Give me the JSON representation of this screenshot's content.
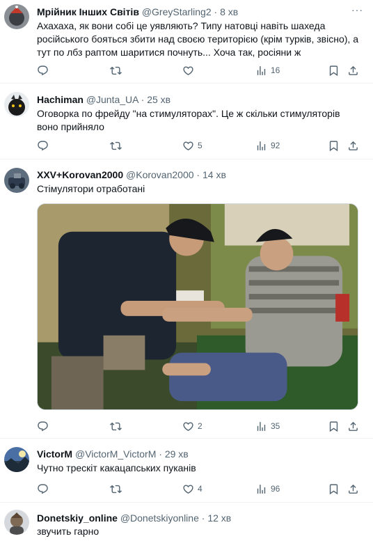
{
  "tweets": [
    {
      "name": "Мрійник Інших Світів",
      "handle": "@GreyStarling2",
      "time": "8 хв",
      "text": "Ахахаха, як вони собі це уявляють? Типу натовці навіть шахеда російського бояться збити над своєю територією (крім турків, звісно), а тут по лбз раптом шаритися почнуть... Хоча так, росіяни ж",
      "replies": "",
      "retweets": "",
      "likes": "",
      "views": "16"
    },
    {
      "name": "Hachiman",
      "handle": "@Junta_UA",
      "time": "25 хв",
      "text": "Оговорка по фрейду \"на стимуляторах\". Це ж скільки стимуляторів воно прийняло",
      "replies": "",
      "retweets": "",
      "likes": "5",
      "views": "92"
    },
    {
      "name": "XXV+Korovan2000",
      "handle": "@Korovan2000",
      "time": "14 хв",
      "text": "Стімулятори отработані",
      "replies": "",
      "retweets": "",
      "likes": "2",
      "views": "35"
    },
    {
      "name": "VictorM",
      "handle": "@VictorM_VictorM",
      "time": "29 хв",
      "text": "Чутно трескіт какацапських пуканів",
      "replies": "",
      "retweets": "",
      "likes": "4",
      "views": "96"
    },
    {
      "name": "Donetskiy_online",
      "handle": "@Donetskiyonline",
      "time": "12 хв",
      "text": "звучить гарно",
      "replies": "",
      "retweets": "",
      "likes": "",
      "views": ""
    }
  ],
  "separator": "·",
  "more_glyph": "···",
  "icons": {
    "reply": "reply-icon",
    "retweet": "retweet-icon",
    "like": "heart-icon",
    "views": "views-icon",
    "bookmark": "bookmark-icon",
    "share": "share-icon"
  },
  "colors": {
    "text": "#0f1419",
    "secondary": "#536471",
    "divider": "#eff3f4"
  }
}
